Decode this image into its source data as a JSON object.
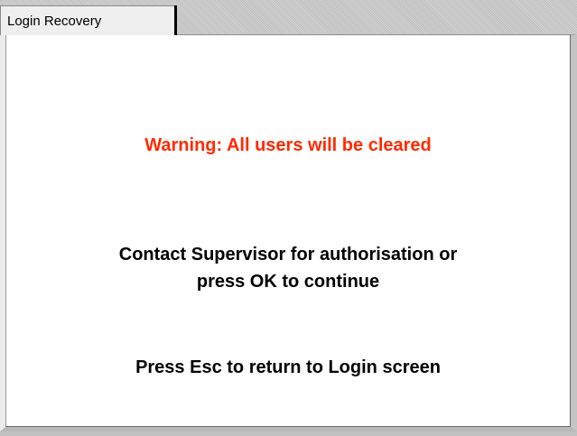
{
  "tab": {
    "label": "Login Recovery"
  },
  "dialog": {
    "warning": "Warning: All users will be cleared",
    "contact_line1": "Contact Supervisor for authorisation or",
    "contact_line2": "press OK to continue",
    "esc_hint": "Press Esc to return to Login screen"
  },
  "colors": {
    "warning_text": "#ff2a00",
    "body_text": "#000000",
    "panel_background": "#ffffff"
  }
}
